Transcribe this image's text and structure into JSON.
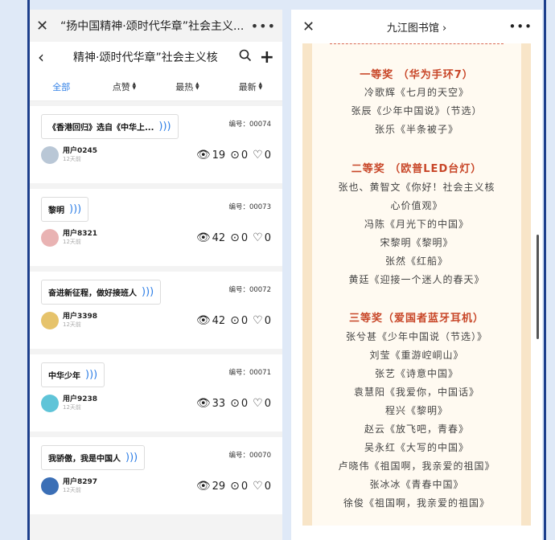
{
  "left": {
    "title": "“扬中国精神·颂时代华章”社会主义...",
    "nav_title": "精神·颂时代华章”社会主义核",
    "tabs": [
      {
        "label": "全部",
        "active": true
      },
      {
        "label": "点赞",
        "active": false
      },
      {
        "label": "最热",
        "active": false
      },
      {
        "label": "最新",
        "active": false
      }
    ],
    "items": [
      {
        "title": "《香港回归》选自《中华上...",
        "code": "编号：00074",
        "user": "用户0245",
        "date": "12天前",
        "views": "19",
        "comments": "0",
        "likes": "0",
        "avatar_color": "#b9c7d6"
      },
      {
        "title": "黎明",
        "code": "编号：00073",
        "user": "用户8321",
        "date": "12天前",
        "views": "42",
        "comments": "0",
        "likes": "0",
        "avatar_color": "#e9b3b3"
      },
      {
        "title": "奋进新征程，做好接班人",
        "code": "编号：00072",
        "user": "用户3398",
        "date": "12天前",
        "views": "42",
        "comments": "0",
        "likes": "0",
        "avatar_color": "#e6c36b"
      },
      {
        "title": "中华少年",
        "code": "编号：00071",
        "user": "用户9238",
        "date": "12天前",
        "views": "33",
        "comments": "0",
        "likes": "0",
        "avatar_color": "#5fc4d8"
      },
      {
        "title": "我骄傲，我是中国人",
        "code": "编号：00070",
        "user": "用户8297",
        "date": "12天前",
        "views": "29",
        "comments": "0",
        "likes": "0",
        "avatar_color": "#3b6fb6"
      }
    ]
  },
  "right": {
    "title": "九江图书馆 ›",
    "lines": [
      {
        "text": "一等奖 （华为手环7）",
        "heading": true
      },
      {
        "text": "冷歌辉《七月的天空》",
        "heading": false
      },
      {
        "text": "张辰《少年中国说》（节选）",
        "heading": false
      },
      {
        "text": "张乐《半条被子》",
        "heading": false
      },
      {
        "text": "二等奖 （欧普LED台灯）",
        "heading": true
      },
      {
        "text": "张也、黄智文《你好！社会主义核",
        "heading": false
      },
      {
        "text": "心价值观》",
        "heading": false
      },
      {
        "text": "冯陈《月光下的中国》",
        "heading": false
      },
      {
        "text": "宋黎明《黎明》",
        "heading": false
      },
      {
        "text": "张然《红船》",
        "heading": false
      },
      {
        "text": "黄廷《迎接一个迷人的春天》",
        "heading": false
      },
      {
        "text": "三等奖（爱国者蓝牙耳机）",
        "heading": true
      },
      {
        "text": "张兮甚《少年中国说（节选）》",
        "heading": false
      },
      {
        "text": "刘莹《重游崆峒山》",
        "heading": false
      },
      {
        "text": "张艺《诗意中国》",
        "heading": false
      },
      {
        "text": "袁慧阳《我爱你，中国话》",
        "heading": false
      },
      {
        "text": "程兴《黎明》",
        "heading": false
      },
      {
        "text": "赵云《放飞吧，青春》",
        "heading": false
      },
      {
        "text": "吴永红《大写的中国》",
        "heading": false
      },
      {
        "text": "卢晓伟《祖国啊，我亲爱的祖国》",
        "heading": false
      },
      {
        "text": "张冰冰《青春中国》",
        "heading": false
      },
      {
        "text": "徐俊《祖国啊，我亲爱的祖国》",
        "heading": false
      }
    ]
  }
}
